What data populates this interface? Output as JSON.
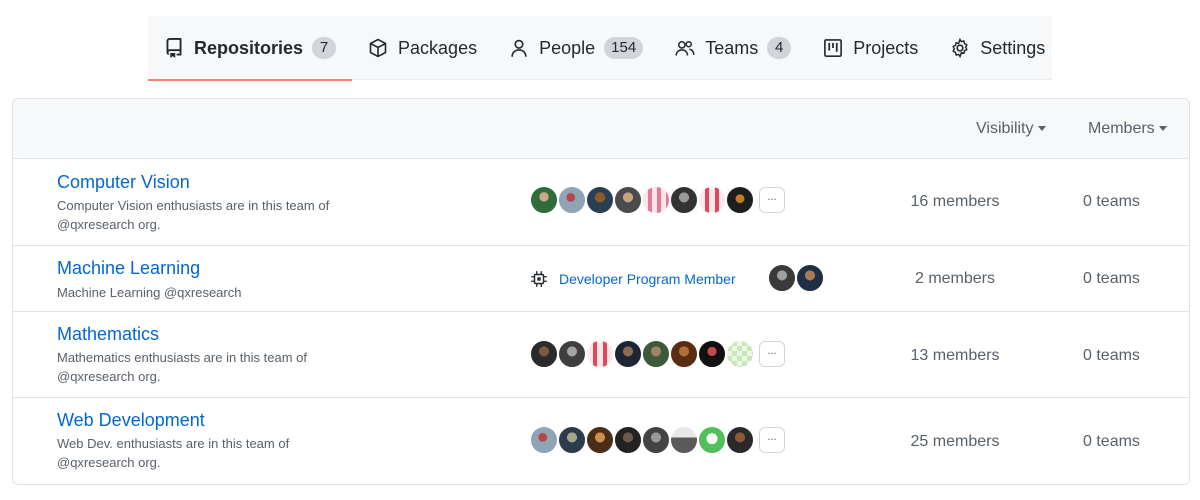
{
  "nav": {
    "tabs": [
      {
        "label": "Repositories",
        "counter": "7",
        "icon": "repo-icon"
      },
      {
        "label": "Packages",
        "icon": "package-icon"
      },
      {
        "label": "People",
        "counter": "154",
        "icon": "person-icon"
      },
      {
        "label": "Teams",
        "counter": "4",
        "icon": "people-icon"
      },
      {
        "label": "Projects",
        "icon": "project-icon"
      },
      {
        "label": "Settings",
        "icon": "gear-icon"
      }
    ]
  },
  "filters": {
    "visibility": "Visibility",
    "members": "Members"
  },
  "teams": [
    {
      "name": "Computer Vision",
      "desc1": "Computer Vision enthusiasts are in this team of",
      "desc2": "@qxresearch org.",
      "members": "16 members",
      "teams": "0 teams",
      "more": "..."
    },
    {
      "name": "Machine Learning",
      "desc1": "Machine Learning @qxresearch",
      "badge": "Developer Program Member",
      "members": "2 members",
      "teams": "0 teams"
    },
    {
      "name": "Mathematics",
      "desc1": "Mathematics enthusiasts are in this team of",
      "desc2": "@qxresearch org.",
      "members": "13 members",
      "teams": "0 teams",
      "more": "..."
    },
    {
      "name": "Web Development",
      "desc1": "Web Dev. enthusiasts are in this team of",
      "desc2": "@qxresearch org.",
      "members": "25 members",
      "teams": "0 teams",
      "more": "..."
    }
  ],
  "colors": {
    "accent_underline": "#f9826c",
    "link": "#0366d6",
    "muted_text": "#586069"
  }
}
